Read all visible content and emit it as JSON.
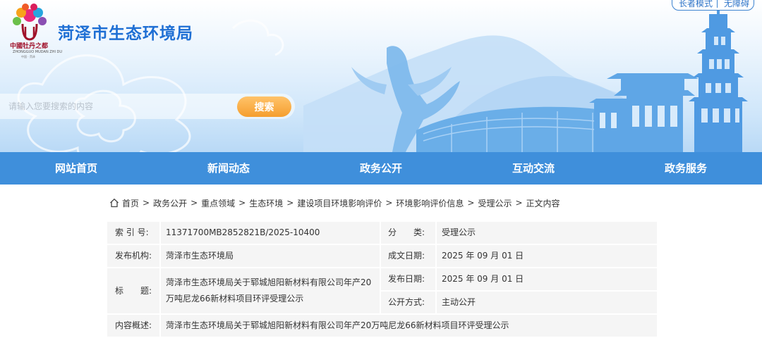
{
  "site": {
    "name": "菏泽市生态环境局",
    "logo_caption": "中國牡丹之都",
    "logo_sub": "ZHONGGUO MUDAN ZHI DU",
    "logo_sub2": "中国 · 菏泽"
  },
  "accessibility": {
    "elder_mode": "长者模式",
    "barrier_free": "无障碍"
  },
  "search": {
    "placeholder": "请输入您要搜索的内容",
    "button_label": "搜索"
  },
  "nav": {
    "items": [
      {
        "label": "网站首页"
      },
      {
        "label": "新闻动态"
      },
      {
        "label": "政务公开"
      },
      {
        "label": "互动交流"
      },
      {
        "label": "政务服务"
      }
    ]
  },
  "breadcrumb": {
    "items": [
      {
        "label": "首页"
      },
      {
        "label": "政务公开"
      },
      {
        "label": "重点领域"
      },
      {
        "label": "生态环境"
      },
      {
        "label": "建设项目环境影响评价"
      },
      {
        "label": "环境影响评价信息"
      },
      {
        "label": "受理公示"
      },
      {
        "label": "正文内容"
      }
    ],
    "separator": ">"
  },
  "info": {
    "index_no_label": "索 引 号:",
    "index_no": "11371700MB2852821B/2025-10400",
    "category_label": "分　　类:",
    "category": "受理公示",
    "publisher_label": "发布机构:",
    "publisher": "菏泽市生态环境局",
    "written_date_label": "成文日期:",
    "written_date": "2025 年 09 月 01 日",
    "title_label": "标　　题:",
    "title": "菏泽市生态环境局关于郓城旭阳新材料有限公司年产20万吨尼龙66新材料项目环评受理公示",
    "publish_date_label": "发布日期:",
    "publish_date": "2025 年 09 月 01 日",
    "disclosure_label": "公开方式:",
    "disclosure": "主动公开",
    "summary_label": "内容概述:",
    "summary": "菏泽市生态环境局关于郓城旭阳新材料有限公司年产20万吨尼龙66新材料项目环评受理公示"
  },
  "colors": {
    "brand_blue": "#1f6fd4",
    "nav_blue": "#3f8fdb",
    "search_orange": "#f59e2e",
    "cell_gray": "#f5f5f5"
  }
}
